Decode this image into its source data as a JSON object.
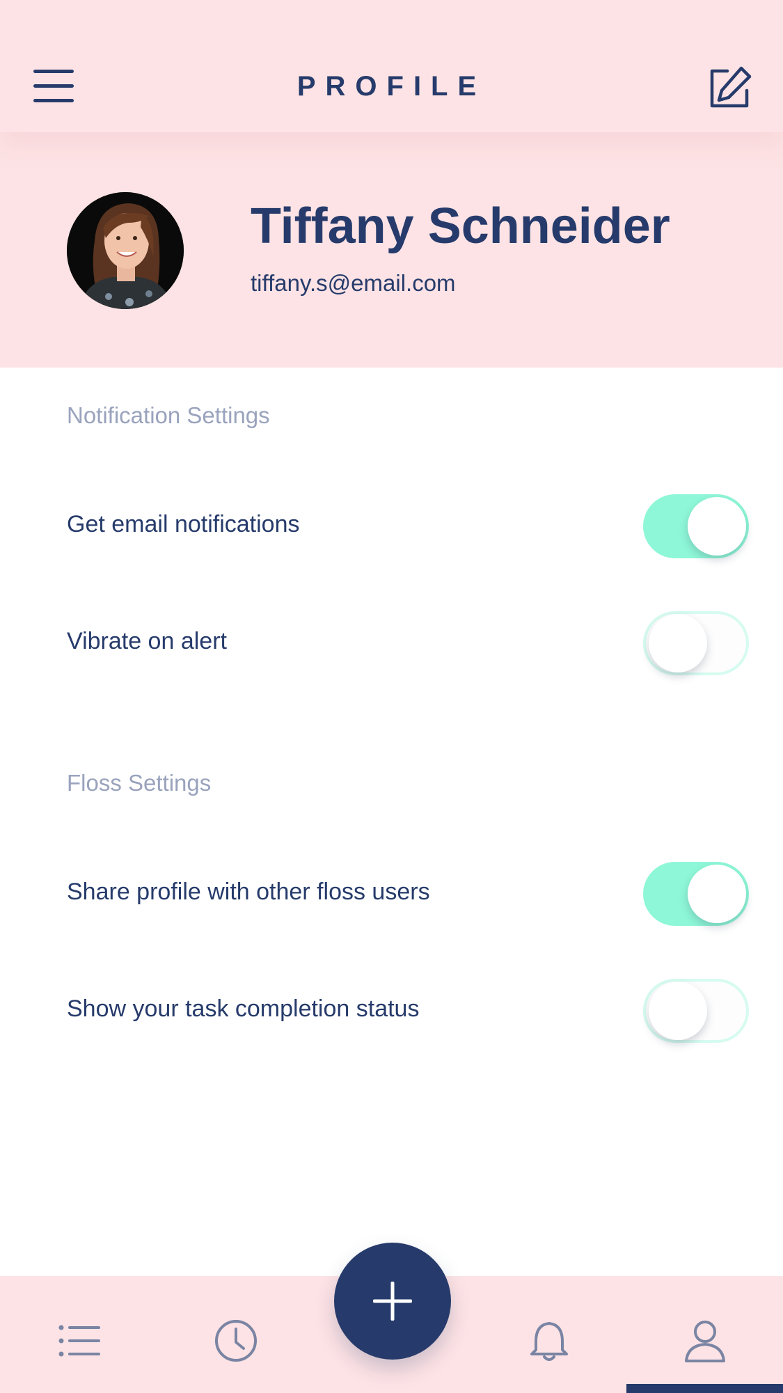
{
  "header": {
    "title": "PROFILE",
    "menu_icon": "hamburger-menu-icon",
    "edit_icon": "edit-square-icon"
  },
  "profile": {
    "name": "Tiffany Schneider",
    "email": "tiffany.s@email.com"
  },
  "sections": [
    {
      "title": "Notification Settings",
      "settings": [
        {
          "label": "Get email notifications",
          "enabled": true
        },
        {
          "label": "Vibrate on alert",
          "enabled": false
        }
      ]
    },
    {
      "title": "Floss Settings",
      "settings": [
        {
          "label": "Share profile with other floss users",
          "enabled": true
        },
        {
          "label": "Show your task completion status",
          "enabled": false
        }
      ]
    }
  ],
  "bottom_nav": {
    "items": [
      "list-icon",
      "clock-icon",
      "plus-icon",
      "bell-icon",
      "user-icon"
    ],
    "active": "user-icon"
  },
  "colors": {
    "header_bg": "#fde3e5",
    "primary_navy": "#263b6b",
    "toggle_on": "#8ef7d7",
    "section_title": "#9aa3bd"
  }
}
